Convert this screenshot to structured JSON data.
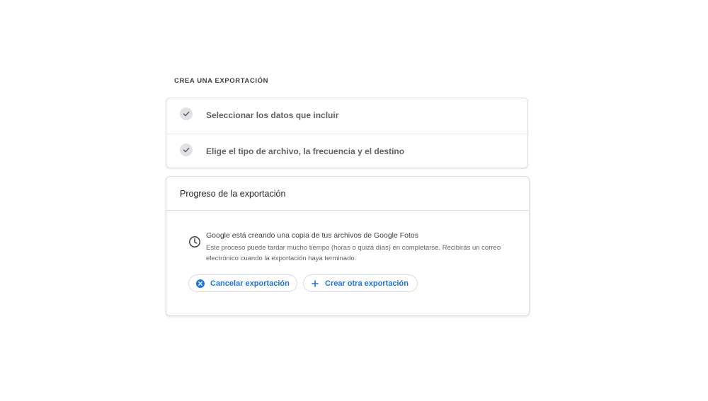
{
  "section": {
    "title": "CREA UNA EXPORTACIÓN"
  },
  "steps": [
    {
      "label": "Seleccionar los datos que incluir",
      "icon": "check-icon",
      "state": "completed"
    },
    {
      "label": "Elige el tipo de archivo, la frecuencia y el destino",
      "icon": "check-icon",
      "state": "completed"
    }
  ],
  "progress": {
    "title": "Progreso de la exportación",
    "icon": "clock-icon",
    "message_primary": "Google está creando una copia de tus archivos de Google Fotos",
    "message_secondary": "Este proceso puede tardar mucho tiempo (horas o quizá días) en completarse. Recibirás un correo electrónico cuando la exportación haya terminado.",
    "buttons": {
      "cancel_label": "Cancelar exportación",
      "cancel_icon": "cancel-circle-icon",
      "create_label": "Crear otra exportación",
      "create_icon": "plus-icon"
    }
  },
  "colors": {
    "accent": "#1a73e8",
    "border": "#dadce0",
    "check_bg": "#dfe1e5"
  }
}
